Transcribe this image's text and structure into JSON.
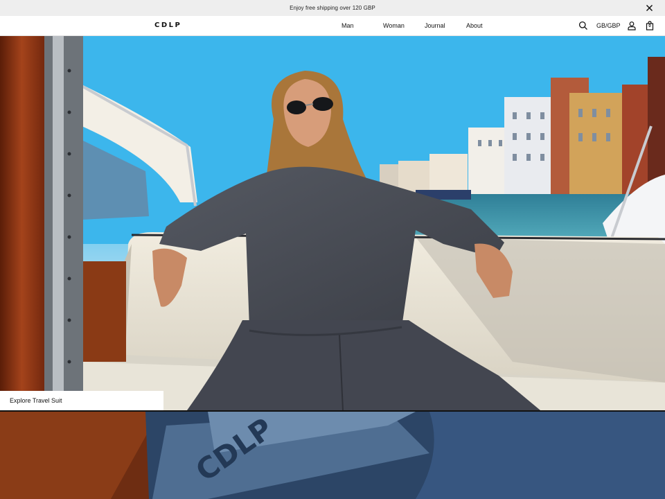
{
  "announcement": {
    "text": "Enjoy free shipping over 120 GBP",
    "close_icon": "close-icon"
  },
  "header": {
    "logo": "CDLP",
    "nav": [
      "Man",
      "Woman",
      "Journal",
      "About"
    ],
    "currency": "GB/GBP",
    "cart_count": "0",
    "icons": [
      "search-icon",
      "account-icon",
      "bag-icon"
    ]
  },
  "hero": {
    "cta_label": "Explore Travel Suit"
  },
  "second_section": {
    "waistband_text": "CDLP"
  },
  "colors": {
    "announce_bg": "#eeeeee",
    "sky": "#35b3ec",
    "suit": "#4a4d55",
    "wood": "#7a2f12"
  }
}
